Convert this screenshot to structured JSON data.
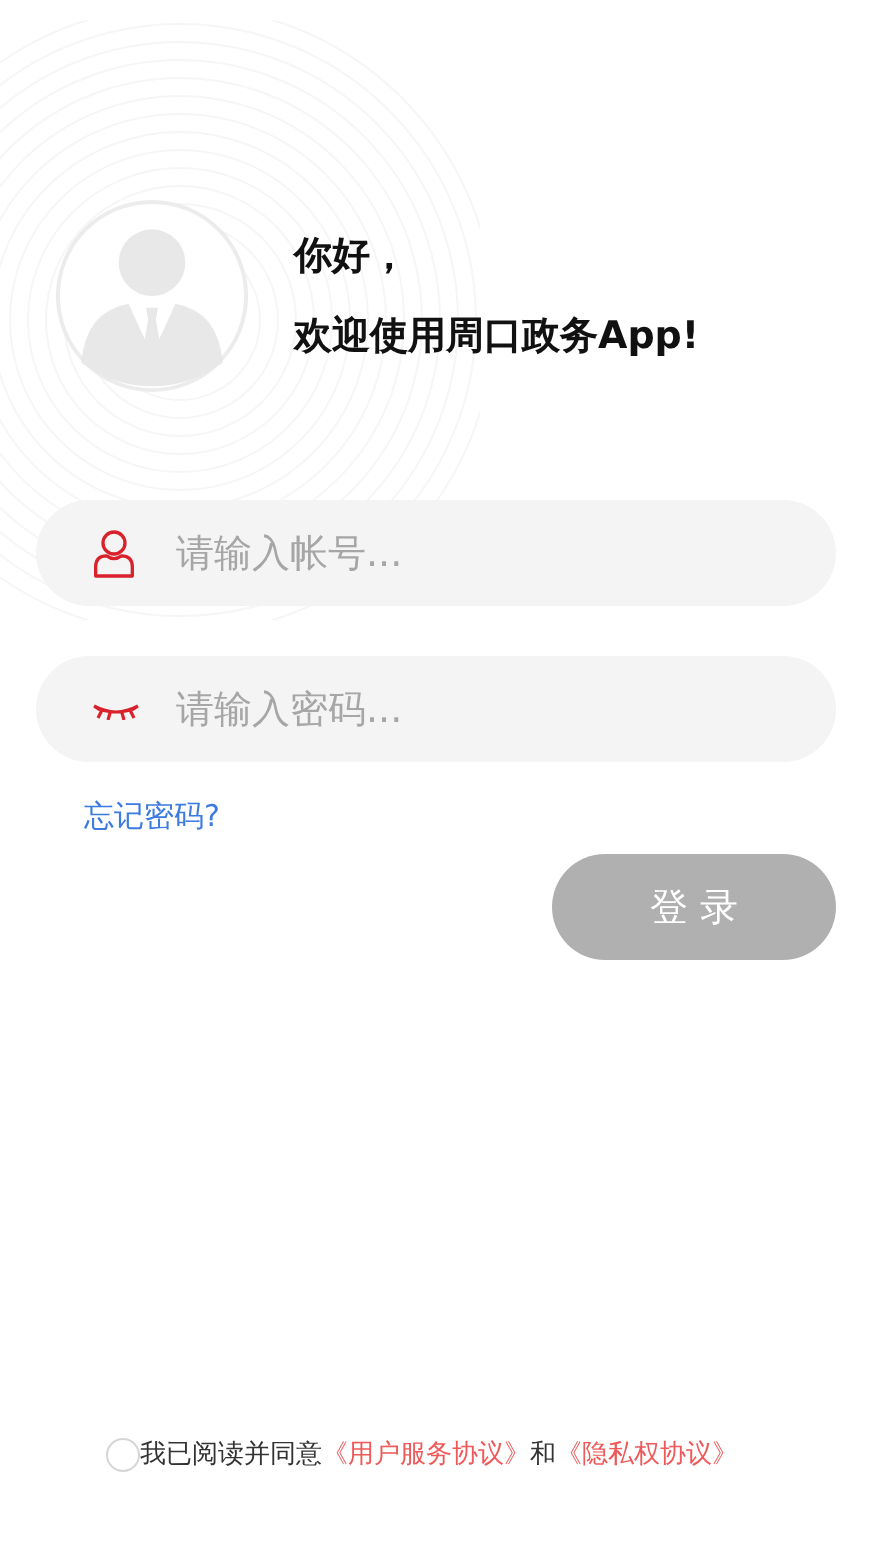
{
  "greeting": [
    "你好，",
    "欢迎使用周口政务App!"
  ],
  "fields": [
    {
      "kind": "account",
      "placeholder": "请输入帐号..."
    },
    {
      "kind": "password",
      "placeholder": "请输入密码..."
    }
  ],
  "forgot_link": "忘记密码?",
  "login_button": {
    "label": "登 录",
    "disabled": true
  },
  "agreement": {
    "checked": false,
    "text": "我已阅读并同意",
    "links": [
      "《用户服务协议》",
      "《隐私权协议》"
    ],
    "joiner": "和"
  }
}
